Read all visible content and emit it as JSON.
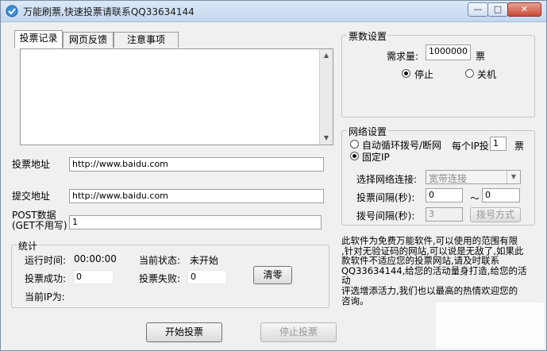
{
  "window": {
    "title": "万能刷票,快速投票请联系QQ33634144",
    "minimize": "—",
    "maximize": "□",
    "close": "✕"
  },
  "tabs": [
    "投票记录",
    "网页反馈",
    "注意事项"
  ],
  "log_text": "",
  "vote_url": {
    "label": "投票地址",
    "value": "http://www.baidu.com"
  },
  "submit_url": {
    "label": "提交地址",
    "value": "http://www.baidu.com"
  },
  "post_data": {
    "label_line1": "POST数据",
    "label_line2": "(GET不用写)",
    "value": "1"
  },
  "stats": {
    "title": "统计",
    "run_time_label": "运行时间:",
    "run_time": "00:00:00",
    "state_label": "当前状态:",
    "state": "未开始",
    "success_label": "投票成功:",
    "success": "0",
    "fail_label": "投票失败:",
    "fail": "0",
    "clear_button": "清零",
    "ip_label": "当前IP为:",
    "ip": ""
  },
  "buttons": {
    "start": "开始投票",
    "stop": "停止投票"
  },
  "ticket_settings": {
    "title": "票数设置",
    "required_label": "需求量:",
    "required_value": "1000000",
    "unit": "票",
    "option_stop": "停止",
    "option_shutdown": "关机",
    "selected": "停止"
  },
  "network": {
    "title": "网络设置",
    "option_dial": "自动循环拨号/断网",
    "per_ip_label": "每个IP投",
    "per_ip_value": "1",
    "per_ip_unit": "票",
    "option_fixed": "固定IP",
    "selected": "固定IP",
    "connection_label": "选择网络连接:",
    "connection_value": "宽带连接",
    "vote_interval_label": "投票间隔(秒):",
    "vote_interval_min": "0",
    "vote_interval_sep": "～",
    "vote_interval_max": "0",
    "dial_interval_label": "拨号间隔(秒):",
    "dial_interval_value": "3",
    "dial_mode_button": "拨号方式"
  },
  "info_lines": [
    "此软件为免费万能软件,可以使用的范围有限",
    ",针对无验证码的网站,可以说是无敌了,如果此",
    "款软件不适应您的投票网站,请及时联系",
    "QQ33634144,给您的活动量身打造,给您的活动",
    "评选增添活力,我们也以最高的热情欢迎您的",
    "咨询。"
  ]
}
